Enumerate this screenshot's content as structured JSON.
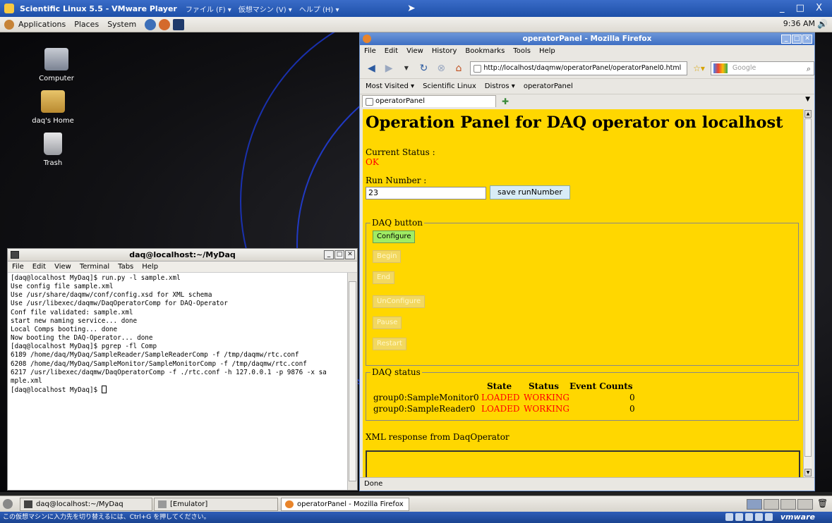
{
  "vmware": {
    "title": "Scientific Linux 5.5 - VMware Player",
    "menus": [
      "ファイル (F) ▾",
      "仮想マシン (V) ▾",
      "ヘルプ (H) ▾"
    ],
    "window_controls": "_ □ X",
    "status_text": "この仮想マシンに入力先を切り替えるには、Ctrl+G を押してください。",
    "brand": "vmware"
  },
  "gnome_panel": {
    "menus": [
      "Applications",
      "Places",
      "System"
    ],
    "clock": "9:36 AM"
  },
  "desktop": {
    "icons": [
      {
        "label": "Computer",
        "icon": "computer-icon"
      },
      {
        "label": "daq's Home",
        "icon": "home-folder-icon"
      },
      {
        "label": "Trash",
        "icon": "trash-icon"
      }
    ]
  },
  "terminal": {
    "title": "daq@localhost:~/MyDaq",
    "menu": [
      "File",
      "Edit",
      "View",
      "Terminal",
      "Tabs",
      "Help"
    ],
    "lines": [
      "[daq@localhost MyDaq]$ run.py -l sample.xml",
      "Use config file sample.xml",
      "Use /usr/share/daqmw/conf/config.xsd for XML schema",
      "Use /usr/libexec/daqmw/DaqOperatorComp for DAQ-Operator",
      "Conf file validated: sample.xml",
      "start new naming service... done",
      "Local Comps booting... done",
      "Now booting the DAQ-Operator... done",
      "[daq@localhost MyDaq]$ pgrep -fl Comp",
      "6189 /home/daq/MyDaq/SampleReader/SampleReaderComp -f /tmp/daqmw/rtc.conf",
      "6208 /home/daq/MyDaq/SampleMonitor/SampleMonitorComp -f /tmp/daqmw/rtc.conf",
      "6217 /usr/libexec/daqmw/DaqOperatorComp -f ./rtc.conf -h 127.0.0.1 -p 9876 -x sa",
      "mple.xml"
    ],
    "prompt": "[daq@localhost MyDaq]$ "
  },
  "firefox": {
    "title": "operatorPanel - Mozilla Firefox",
    "menu": [
      "File",
      "Edit",
      "View",
      "History",
      "Bookmarks",
      "Tools",
      "Help"
    ],
    "url": "http://localhost/daqmw/operatorPanel/operatorPanel0.html",
    "search_placeholder": "Google",
    "bookmarks": [
      "Most Visited ▾",
      "Scientific Linux",
      "Distros ▾",
      "operatorPanel"
    ],
    "tab_label": "operatorPanel",
    "status": "Done"
  },
  "panel": {
    "heading": "Operation Panel for DAQ operator on localhost",
    "current_status_label": "Current Status :",
    "current_status_value": "OK",
    "run_number_label": "Run Number :",
    "run_number_value": "23",
    "save_button": "save runNumber",
    "daq_button_legend": "DAQ button",
    "buttons": {
      "configure": "Configure",
      "begin": "Begin",
      "end": "End",
      "unconfigure": "UnConfigure",
      "pause": "Pause",
      "restart": "Restart"
    },
    "daq_status_legend": "DAQ status",
    "status_headers": [
      "State",
      "Status",
      "Event Counts"
    ],
    "components": [
      {
        "name": "group0:SampleMonitor0",
        "state": "LOADED",
        "status": "WORKING",
        "events": "0"
      },
      {
        "name": "group0:SampleReader0",
        "state": "LOADED",
        "status": "WORKING",
        "events": "0"
      }
    ],
    "xml_label": "XML response from DaqOperator"
  },
  "taskbar": {
    "tasks": [
      "daq@localhost:~/MyDaq",
      "[Emulator]",
      "operatorPanel - Mozilla Firefox"
    ]
  }
}
